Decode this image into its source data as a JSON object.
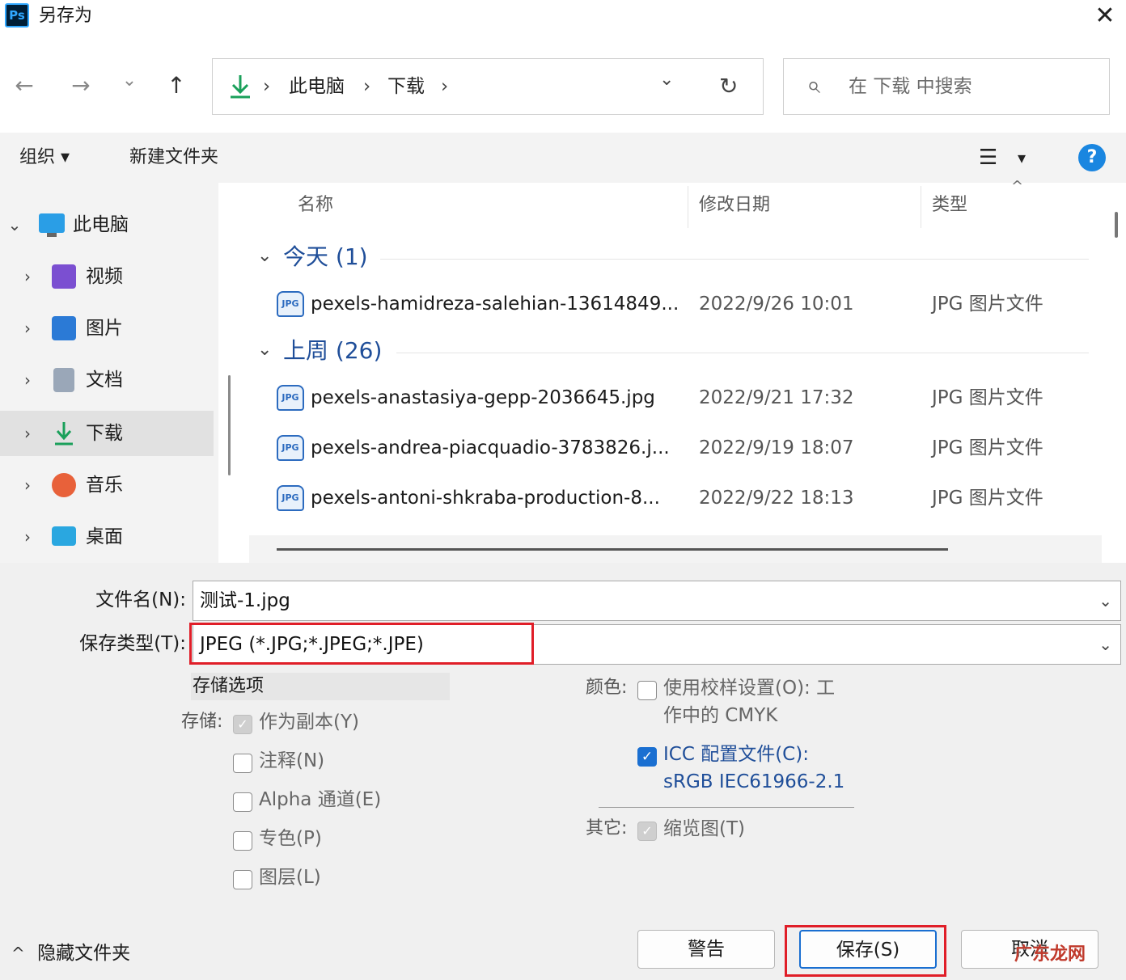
{
  "window": {
    "title": "另存为",
    "app_badge": "Ps",
    "close_glyph": "✕"
  },
  "nav": {
    "back_glyph": "←",
    "forward_glyph": "→",
    "recent_glyph": "⌄",
    "up_glyph": "↑",
    "breadcrumb": [
      "此电脑",
      "下载"
    ],
    "sep_glyph": "›",
    "dropdown_glyph": "⌄",
    "refresh_glyph": "↻",
    "search_placeholder": "在 下载 中搜索",
    "search_glyph": "⌕"
  },
  "toolbar": {
    "organize": "组织 ▾",
    "new_folder": "新建文件夹",
    "view_glyph": "☰",
    "view_menu_glyph": "▾",
    "help_glyph": "?"
  },
  "sidebar": {
    "root": {
      "label": "此电脑",
      "chev": "⌄"
    },
    "items": [
      {
        "label": "视频",
        "chev": "›",
        "icon": "video-folder-icon",
        "color": "#7b4fd1"
      },
      {
        "label": "图片",
        "chev": "›",
        "icon": "pictures-folder-icon",
        "color": "#2b7ad6"
      },
      {
        "label": "文档",
        "chev": "›",
        "icon": "documents-folder-icon",
        "color": "#9aa7b8"
      },
      {
        "label": "下载",
        "chev": "›",
        "icon": "downloads-folder-icon",
        "color": "#1aa05a"
      },
      {
        "label": "音乐",
        "chev": "›",
        "icon": "music-folder-icon",
        "color": "#e8613a"
      },
      {
        "label": "桌面",
        "chev": "›",
        "icon": "desktop-folder-icon",
        "color": "#2aa7e0"
      }
    ]
  },
  "list": {
    "columns": {
      "name": "名称",
      "date": "修改日期",
      "type": "类型",
      "sort_glyph": "^"
    },
    "groups": [
      {
        "label": "今天 (1)",
        "files": [
          {
            "name": "pexels-hamidreza-salehian-13614849...",
            "date": "2022/9/26 10:01",
            "type": "JPG 图片文件"
          }
        ]
      },
      {
        "label": "上周 (26)",
        "files": [
          {
            "name": "pexels-anastasiya-gepp-2036645.jpg",
            "date": "2022/9/21 17:32",
            "type": "JPG 图片文件"
          },
          {
            "name": "pexels-andrea-piacquadio-3783826.j...",
            "date": "2022/9/19 18:07",
            "type": "JPG 图片文件"
          },
          {
            "name": "pexels-antoni-shkraba-production-8...",
            "date": "2022/9/22 18:13",
            "type": "JPG 图片文件"
          }
        ]
      }
    ],
    "group_glyph": "⌄",
    "file_icon_text": "JPG"
  },
  "form": {
    "filename_label": "文件名(N):",
    "filename_value": "测试-1.jpg",
    "filetype_label": "保存类型(T):",
    "filetype_value": "JPEG (*.JPG;*.JPEG;*.JPE)",
    "dd_glyph": "⌄",
    "options_header": "存储选项",
    "storage_label": "存储:",
    "storage_options": [
      {
        "label": "作为副本(Y)",
        "state": "disabled-checked"
      },
      {
        "label": "注释(N)",
        "state": "off"
      },
      {
        "label": "Alpha 通道(E)",
        "state": "off"
      },
      {
        "label": "专色(P)",
        "state": "off"
      },
      {
        "label": "图层(L)",
        "state": "off"
      }
    ],
    "color_label": "颜色:",
    "proof_line1": "使用校样设置(O): 工",
    "proof_line2": "作中的 CMYK",
    "icc_line1": "ICC 配置文件(C):",
    "icc_line2": "sRGB IEC61966-2.1",
    "other_label": "其它:",
    "thumbnail_label": "缩览图(T)",
    "check_glyph": "✓"
  },
  "footer": {
    "hide_folders": "隐藏文件夹",
    "hide_glyph": "^",
    "warn_button": "警告",
    "save_button": "保存(S)",
    "cancel_button": "取消",
    "watermark": "广东龙网"
  }
}
